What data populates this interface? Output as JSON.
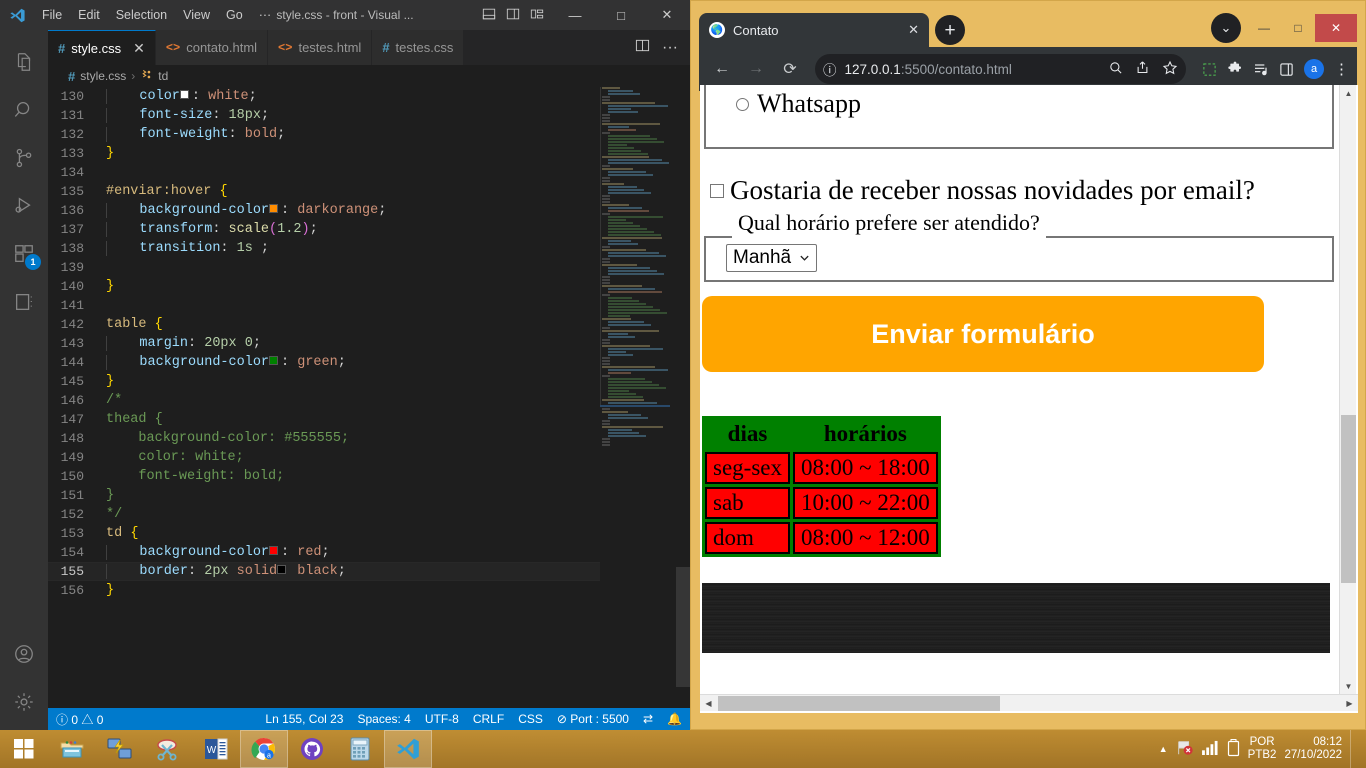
{
  "vscode": {
    "menu": [
      "File",
      "Edit",
      "Selection",
      "View",
      "Go",
      "···"
    ],
    "title": "style.css - front - Visual ...",
    "window_controls": {
      "minimize": "—",
      "maximize": "□",
      "close": "✕"
    },
    "tabs": [
      {
        "label": "style.css",
        "icon": "css-file-icon",
        "active": true
      },
      {
        "label": "contato.html",
        "icon": "html-file-icon",
        "active": false
      },
      {
        "label": "testes.html",
        "icon": "html-file-icon",
        "active": false
      },
      {
        "label": "testes.css",
        "icon": "css-file-icon",
        "active": false
      }
    ],
    "breadcrumb": {
      "file": "style.css",
      "symbol": "td",
      "separator": "›"
    },
    "activity_bar": [
      {
        "name": "explorer",
        "badge": null
      },
      {
        "name": "search",
        "badge": null
      },
      {
        "name": "source-control",
        "badge": null
      },
      {
        "name": "run-debug",
        "badge": null
      },
      {
        "name": "extensions",
        "badge": "1"
      },
      {
        "name": "testing",
        "badge": null
      }
    ],
    "status": {
      "errors": "0",
      "warnings": "0",
      "position": "Ln 155, Col 23",
      "spaces": "Spaces: 4",
      "encoding": "UTF-8",
      "eol": "CRLF",
      "language": "CSS",
      "port": "Port : 5500"
    },
    "code": [
      {
        "n": "130",
        "tokens": [
          {
            "t": "  ",
            "c": "ind"
          },
          {
            "t": "color",
            "c": "prop"
          },
          {
            "t": ": ",
            "c": "txt"
          },
          {
            "t": "white",
            "c": "val"
          },
          {
            "t": ";",
            "c": "txt"
          }
        ],
        "swatch": "#ffffff",
        "swatch_after": 2
      },
      {
        "n": "131",
        "tokens": [
          {
            "t": "  ",
            "c": "ind"
          },
          {
            "t": "font-size",
            "c": "prop"
          },
          {
            "t": ": ",
            "c": "txt"
          },
          {
            "t": "18px",
            "c": "num"
          },
          {
            "t": ";",
            "c": "txt"
          }
        ]
      },
      {
        "n": "132",
        "tokens": [
          {
            "t": "  ",
            "c": "ind"
          },
          {
            "t": "font-weight",
            "c": "prop"
          },
          {
            "t": ": ",
            "c": "txt"
          },
          {
            "t": "bold",
            "c": "val"
          },
          {
            "t": ";",
            "c": "txt"
          }
        ]
      },
      {
        "n": "133",
        "tokens": [
          {
            "t": "}",
            "c": "yellow"
          }
        ]
      },
      {
        "n": "134",
        "tokens": []
      },
      {
        "n": "135",
        "tokens": [
          {
            "t": "#enviar",
            "c": "sel"
          },
          {
            "t": ":hover",
            "c": "sel"
          },
          {
            "t": " ",
            "c": "txt"
          },
          {
            "t": "{",
            "c": "yellow"
          }
        ]
      },
      {
        "n": "136",
        "tokens": [
          {
            "t": "  ",
            "c": "ind"
          },
          {
            "t": "background-color",
            "c": "prop"
          },
          {
            "t": ": ",
            "c": "txt"
          },
          {
            "t": "darkorange",
            "c": "val"
          },
          {
            "t": ";",
            "c": "txt"
          }
        ],
        "swatch": "#ff8c00",
        "swatch_after": 2
      },
      {
        "n": "137",
        "tokens": [
          {
            "t": "  ",
            "c": "ind"
          },
          {
            "t": "transform",
            "c": "prop"
          },
          {
            "t": ": ",
            "c": "txt"
          },
          {
            "t": "scale",
            "c": "func"
          },
          {
            "t": "(",
            "c": "paren"
          },
          {
            "t": "1.2",
            "c": "num"
          },
          {
            "t": ")",
            "c": "paren"
          },
          {
            "t": ";",
            "c": "txt"
          }
        ]
      },
      {
        "n": "138",
        "tokens": [
          {
            "t": "  ",
            "c": "ind"
          },
          {
            "t": "transition",
            "c": "prop"
          },
          {
            "t": ": ",
            "c": "txt"
          },
          {
            "t": "1s",
            "c": "num"
          },
          {
            "t": " ;",
            "c": "txt"
          }
        ]
      },
      {
        "n": "139",
        "tokens": []
      },
      {
        "n": "140",
        "tokens": [
          {
            "t": "}",
            "c": "yellow"
          }
        ]
      },
      {
        "n": "141",
        "tokens": []
      },
      {
        "n": "142",
        "tokens": [
          {
            "t": "table",
            "c": "sel"
          },
          {
            "t": " ",
            "c": "txt"
          },
          {
            "t": "{",
            "c": "yellow"
          }
        ]
      },
      {
        "n": "143",
        "tokens": [
          {
            "t": "  ",
            "c": "ind"
          },
          {
            "t": "margin",
            "c": "prop"
          },
          {
            "t": ": ",
            "c": "txt"
          },
          {
            "t": "20px 0",
            "c": "num"
          },
          {
            "t": ";",
            "c": "txt"
          }
        ]
      },
      {
        "n": "144",
        "tokens": [
          {
            "t": "  ",
            "c": "ind"
          },
          {
            "t": "background-color",
            "c": "prop"
          },
          {
            "t": ": ",
            "c": "txt"
          },
          {
            "t": "green",
            "c": "val"
          },
          {
            "t": ";",
            "c": "txt"
          }
        ],
        "swatch": "#008000",
        "swatch_after": 2
      },
      {
        "n": "145",
        "tokens": [
          {
            "t": "}",
            "c": "yellow"
          }
        ]
      },
      {
        "n": "146",
        "tokens": [
          {
            "t": "/*",
            "c": "comment"
          }
        ]
      },
      {
        "n": "147",
        "tokens": [
          {
            "t": "thead {",
            "c": "comment"
          }
        ]
      },
      {
        "n": "148",
        "tokens": [
          {
            "t": "    background-color: #555555;",
            "c": "comment"
          }
        ]
      },
      {
        "n": "149",
        "tokens": [
          {
            "t": "    color: white;",
            "c": "comment"
          }
        ]
      },
      {
        "n": "150",
        "tokens": [
          {
            "t": "    font-weight: bold;",
            "c": "comment"
          }
        ]
      },
      {
        "n": "151",
        "tokens": [
          {
            "t": "}",
            "c": "comment"
          }
        ]
      },
      {
        "n": "152",
        "tokens": [
          {
            "t": "*/",
            "c": "comment"
          }
        ]
      },
      {
        "n": "153",
        "tokens": [
          {
            "t": "td",
            "c": "sel"
          },
          {
            "t": " ",
            "c": "txt"
          },
          {
            "t": "{",
            "c": "yellow"
          }
        ]
      },
      {
        "n": "154",
        "tokens": [
          {
            "t": "  ",
            "c": "ind"
          },
          {
            "t": "background-color",
            "c": "prop"
          },
          {
            "t": ": ",
            "c": "txt"
          },
          {
            "t": "red",
            "c": "val"
          },
          {
            "t": ";",
            "c": "txt"
          }
        ],
        "swatch": "#ff0000",
        "swatch_after": 2
      },
      {
        "n": "155",
        "tokens": [
          {
            "t": "  ",
            "c": "ind"
          },
          {
            "t": "border",
            "c": "prop"
          },
          {
            "t": ": ",
            "c": "txt"
          },
          {
            "t": "2px",
            "c": "num"
          },
          {
            "t": " ",
            "c": "txt"
          },
          {
            "t": "solid",
            "c": "val"
          },
          {
            "t": " ",
            "c": "txt"
          },
          {
            "t": "black",
            "c": "val"
          },
          {
            "t": ";",
            "c": "txt"
          }
        ],
        "swatch": "#000000",
        "swatch_after": 6,
        "current": true
      },
      {
        "n": "156",
        "tokens": [
          {
            "t": "}",
            "c": "yellow"
          }
        ]
      }
    ]
  },
  "chrome": {
    "tab": {
      "title": "Contato",
      "close": "✕"
    },
    "new_tab": "+",
    "tab_list_chevron": "⌄",
    "window_controls": {
      "minimize": "—",
      "maximize": "□",
      "close": "✕"
    },
    "nav": {
      "back": "←",
      "forward": "→",
      "reload": "⟳"
    },
    "url": {
      "info_icon": "ⓘ",
      "host": "127.0.0.1",
      "rest": ":5500/contato.html"
    },
    "omnibox_icons": [
      "zoom-icon",
      "share-icon",
      "bookmark-star-icon"
    ],
    "toolbar_icons": [
      "devtools-inspect-icon",
      "extensions-puzzle-icon",
      "reading-list-icon",
      "side-panel-icon"
    ],
    "avatar_letter": "a",
    "menu_dots": "⋮"
  },
  "page": {
    "radio_whatsapp": "Whatsapp",
    "checkbox_news": "Gostaria de receber nossas novidades por email?",
    "fieldset_legend": "Qual horário prefere ser atendido?",
    "select_value": "Manhã",
    "select_chevron": "⌄",
    "submit_label": "Enviar formulário",
    "table": {
      "headers": [
        "dias",
        "horários"
      ],
      "rows": [
        [
          "seg-sex",
          "08:00 ~ 18:00"
        ],
        [
          "sab",
          "10:00 ~ 22:00"
        ],
        [
          "dom",
          "08:00 ~ 12:00"
        ]
      ]
    },
    "colors": {
      "table_bg": "#008000",
      "cell_bg": "#ff0000",
      "submit_bg": "#ffa500"
    }
  },
  "taskbar": {
    "items": [
      {
        "name": "start-button",
        "running": false
      },
      {
        "name": "file-explorer",
        "running": false
      },
      {
        "name": "remote-desktop",
        "running": false
      },
      {
        "name": "snipping-tool",
        "running": false
      },
      {
        "name": "microsoft-word",
        "running": false
      },
      {
        "name": "google-chrome",
        "running": true
      },
      {
        "name": "github-desktop",
        "running": false
      },
      {
        "name": "calculator",
        "running": false
      },
      {
        "name": "visual-studio-code",
        "running": true
      }
    ],
    "tray": {
      "overflow": "▲",
      "language_top": "POR",
      "language_bottom": "PTB2",
      "time": "08:12",
      "date": "27/10/2022"
    }
  }
}
